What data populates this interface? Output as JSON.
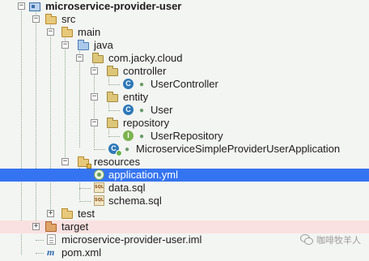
{
  "project_tree": {
    "root": {
      "label": "microservice-provider-user",
      "expanded": true
    },
    "src": {
      "label": "src",
      "expanded": true
    },
    "main": {
      "label": "main",
      "expanded": true
    },
    "java": {
      "label": "java",
      "expanded": true
    },
    "package": {
      "label": "com.jacky.cloud",
      "expanded": true
    },
    "controller": {
      "label": "controller",
      "expanded": true
    },
    "user_controller": {
      "label": "UserController",
      "icon": "class-icon"
    },
    "entity": {
      "label": "entity",
      "expanded": true
    },
    "user": {
      "label": "User",
      "icon": "class-icon"
    },
    "repository": {
      "label": "repository",
      "expanded": true
    },
    "user_repository": {
      "label": "UserRepository",
      "icon": "interface-icon"
    },
    "application_class": {
      "label": "MicroserviceSimpleProviderUserApplication",
      "icon": "spring-boot-class-icon"
    },
    "resources": {
      "label": "resources",
      "expanded": true
    },
    "application_yml": {
      "label": "application.yml",
      "selected": true
    },
    "data_sql": {
      "label": "data.sql"
    },
    "schema_sql": {
      "label": "schema.sql"
    },
    "test": {
      "label": "test",
      "expanded": false
    },
    "target": {
      "label": "target",
      "expanded": false
    },
    "iml_file": {
      "label": "microservice-provider-user.iml"
    },
    "pom_xml": {
      "label": "pom.xml"
    }
  },
  "icon_glyphs": {
    "class": "C",
    "interface": "I",
    "sql": "SQL",
    "maven": "m",
    "collapse": "−",
    "expand": "+"
  },
  "watermark": {
    "text": "咖啡牧羊人"
  },
  "colors": {
    "selection": "#3574f0",
    "excluded_folder_bg": "#fae1e1",
    "tree_bg": "#f3f5f2"
  }
}
